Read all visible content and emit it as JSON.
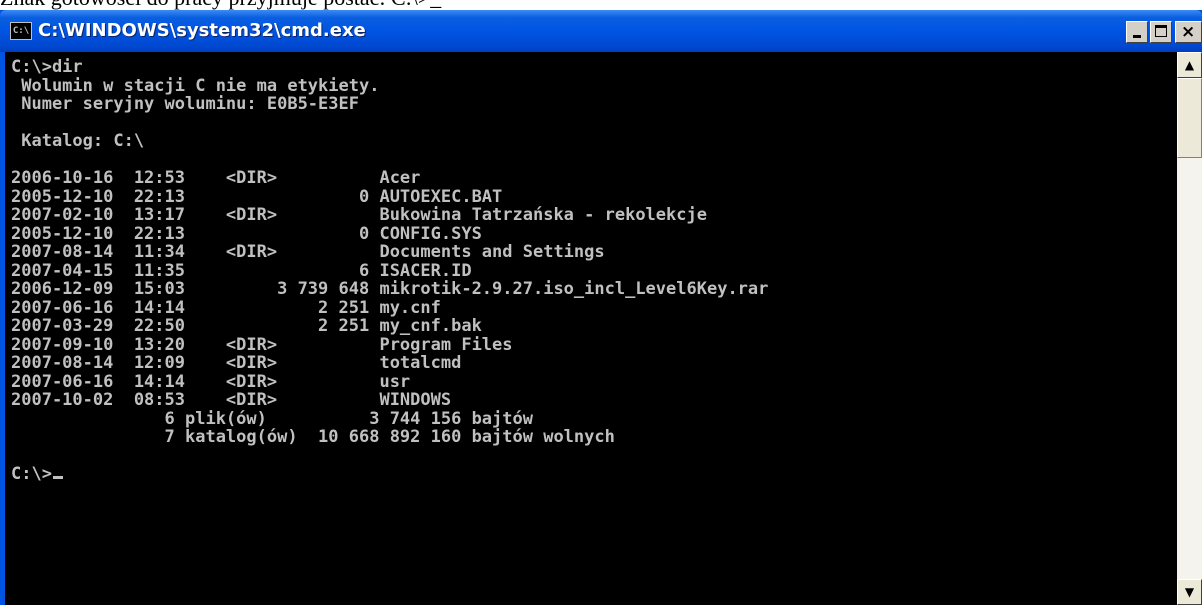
{
  "document": {
    "text_above": "Znak gotowości do pracy przyjmuje postać: C:\\>_"
  },
  "window": {
    "title": "C:\\WINDOWS\\system32\\cmd.exe",
    "icon": "cmd-icon",
    "icon_label": "C:\\",
    "buttons": {
      "minimize_icon": "minimize-icon",
      "maximize_icon": "maximize-icon",
      "close_icon": "close-icon",
      "close_glyph": "×"
    }
  },
  "console": {
    "lines": [
      "C:\\>dir",
      " Wolumin w stacji C nie ma etykiety.",
      " Numer seryjny woluminu: E0B5-E3EF",
      "",
      " Katalog: C:\\",
      "",
      "2006-10-16  12:53    <DIR>          Acer",
      "2005-12-10  22:13                 0 AUTOEXEC.BAT",
      "2007-02-10  13:17    <DIR>          Bukowina Tatrzańska - rekolekcje",
      "2005-12-10  22:13                 0 CONFIG.SYS",
      "2007-08-14  11:34    <DIR>          Documents and Settings",
      "2007-04-15  11:35                 6 ISACER.ID",
      "2006-12-09  15:03         3 739 648 mikrotik-2.9.27.iso_incl_Level6Key.rar",
      "2007-06-16  14:14             2 251 my.cnf",
      "2007-03-29  22:50             2 251 my_cnf.bak",
      "2007-09-10  13:20    <DIR>          Program Files",
      "2007-08-14  12:09    <DIR>          totalcmd",
      "2007-06-16  14:14    <DIR>          usr",
      "2007-10-02  08:53    <DIR>          WINDOWS",
      "               6 plik(ów)          3 744 156 bajtów",
      "               7 katalog(ów)  10 668 892 160 bajtów wolnych",
      ""
    ],
    "prompt": "C:\\>",
    "colors": {
      "background": "#000000",
      "text": "#c0c0c0"
    }
  },
  "scrollbar": {
    "up_glyph": "▲",
    "down_glyph": "▼"
  },
  "colors": {
    "titlebar": "#0054e3",
    "title_text": "#ffffff"
  }
}
